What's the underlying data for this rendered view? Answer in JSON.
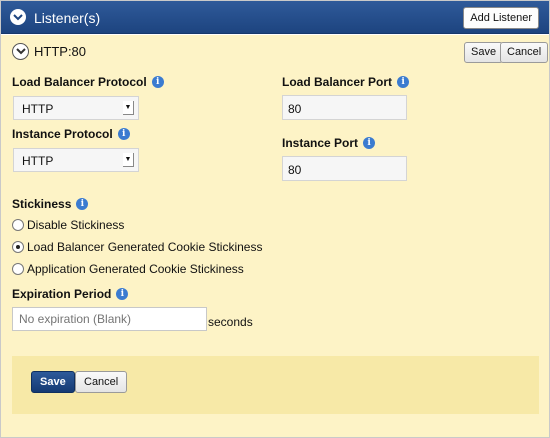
{
  "header": {
    "title": "Listener(s)",
    "add_listener_label": "Add Listener",
    "toggle_icon": "chevron-down-icon"
  },
  "listener": {
    "title": "HTTP:80",
    "save_label": "Save",
    "cancel_label": "Cancel",
    "toggle_icon": "chevron-down-icon"
  },
  "form": {
    "lb_protocol": {
      "label": "Load Balancer Protocol",
      "value": "HTTP"
    },
    "lb_port": {
      "label": "Load Balancer Port",
      "value": "80"
    },
    "instance_protocol": {
      "label": "Instance Protocol",
      "value": "HTTP"
    },
    "instance_port": {
      "label": "Instance Port",
      "value": "80"
    },
    "info_glyph": "i",
    "stickiness": {
      "label": "Stickiness",
      "options": [
        {
          "label": "Disable Stickiness",
          "selected": false
        },
        {
          "label": "Load Balancer Generated Cookie Stickiness",
          "selected": true
        },
        {
          "label": "Application Generated Cookie Stickiness",
          "selected": false
        }
      ]
    },
    "expiration": {
      "label": "Expiration Period",
      "placeholder": "No expiration (Blank)",
      "unit": "seconds"
    }
  },
  "footer": {
    "save_label": "Save",
    "cancel_label": "Cancel"
  },
  "colors": {
    "header_bg": "#1d447f",
    "body_bg": "#fdf3c6",
    "footer_bg": "#f7e9a7",
    "info_icon": "#3b7bd0"
  }
}
